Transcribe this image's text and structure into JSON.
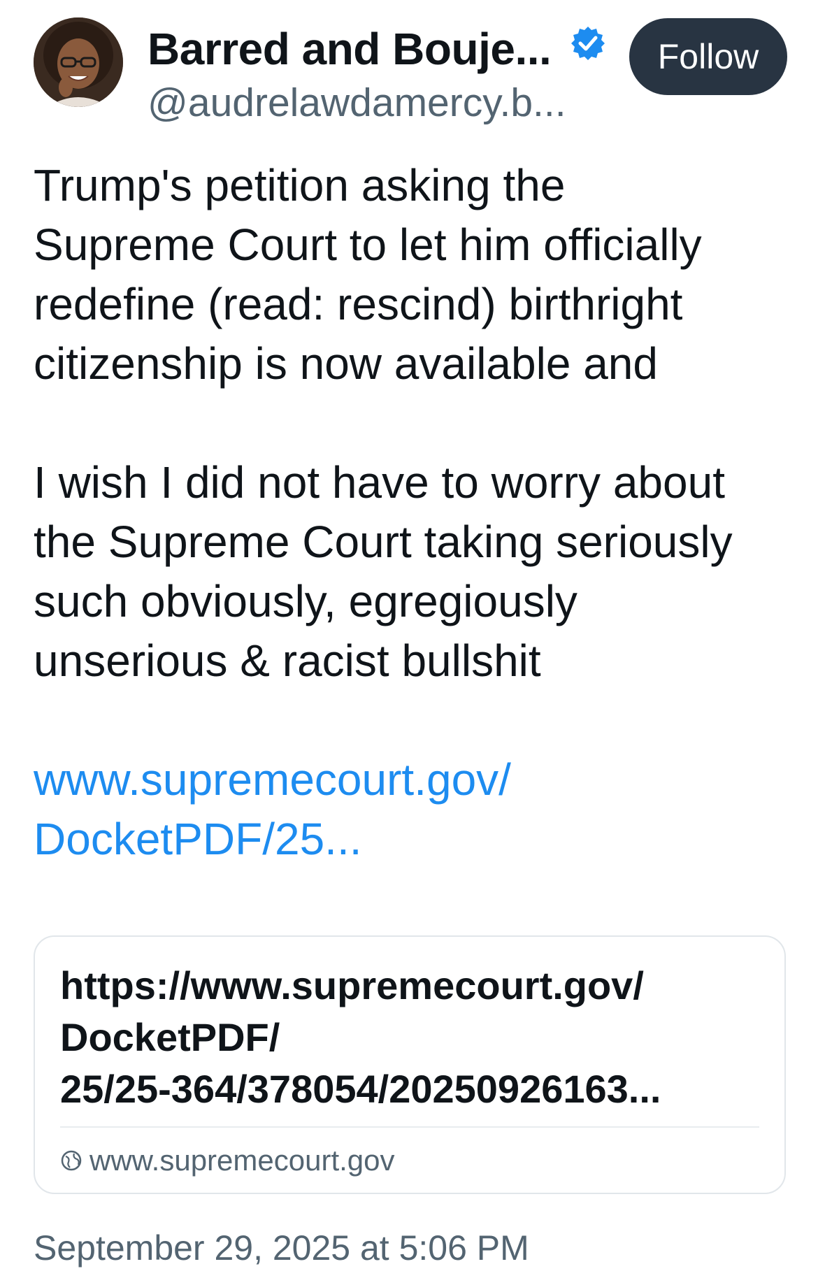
{
  "author": {
    "display_name": "Barred and Bouje...",
    "handle": "@audrelawdamercy.b...",
    "verified_icon": "verified-check-icon",
    "avatar": "profile-photo"
  },
  "follow_label": "Follow",
  "post": {
    "paragraph1": [
      "Trump's petition asking the",
      "Supreme Court to let him officially",
      "redefine (read: rescind) birthright",
      "citizenship is now available and"
    ],
    "paragraph2": [
      "I wish I did not have to worry about",
      "the Supreme Court taking seriously",
      "such obviously, egregiously",
      "unserious & racist bullshit"
    ],
    "link_lines": [
      "www.supremecourt.gov/",
      "DocketPDF/25..."
    ]
  },
  "link_card": {
    "title_lines": [
      "https://www.supremecourt.gov/",
      "DocketPDF/",
      "25/25-364/378054/20250926163..."
    ],
    "domain": "www.supremecourt.gov",
    "domain_icon": "globe-icon"
  },
  "timestamp": "September 29, 2025 at 5:06 PM",
  "colors": {
    "link": "#1d8cf0",
    "follow_button": "#283442",
    "verified": "#1d8cf0",
    "secondary_text": "#536471"
  }
}
